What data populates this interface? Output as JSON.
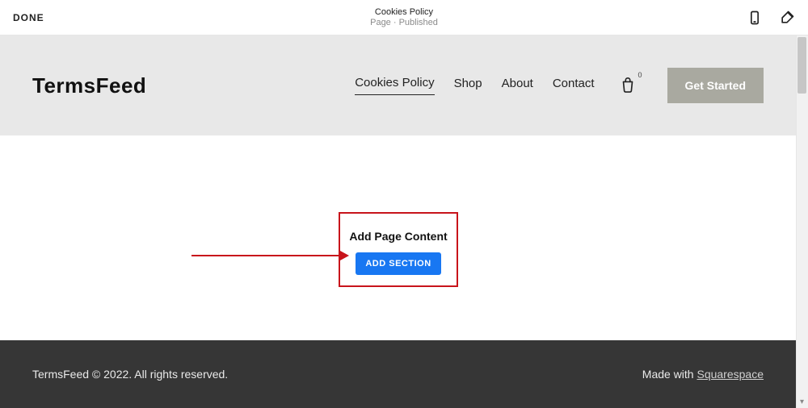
{
  "editor": {
    "done": "DONE",
    "title": "Cookies Policy",
    "subtitle": "Page · Published"
  },
  "site": {
    "logo": "TermsFeed",
    "nav": {
      "cookies": "Cookies Policy",
      "shop": "Shop",
      "about": "About",
      "contact": "Contact"
    },
    "cart_count": "0",
    "cta": "Get Started"
  },
  "canvas": {
    "add_title": "Add Page Content",
    "add_button": "ADD SECTION"
  },
  "footer": {
    "copyright": "TermsFeed © 2022. All rights reserved.",
    "made_with_prefix": "Made with ",
    "made_with_link": "Squarespace"
  }
}
